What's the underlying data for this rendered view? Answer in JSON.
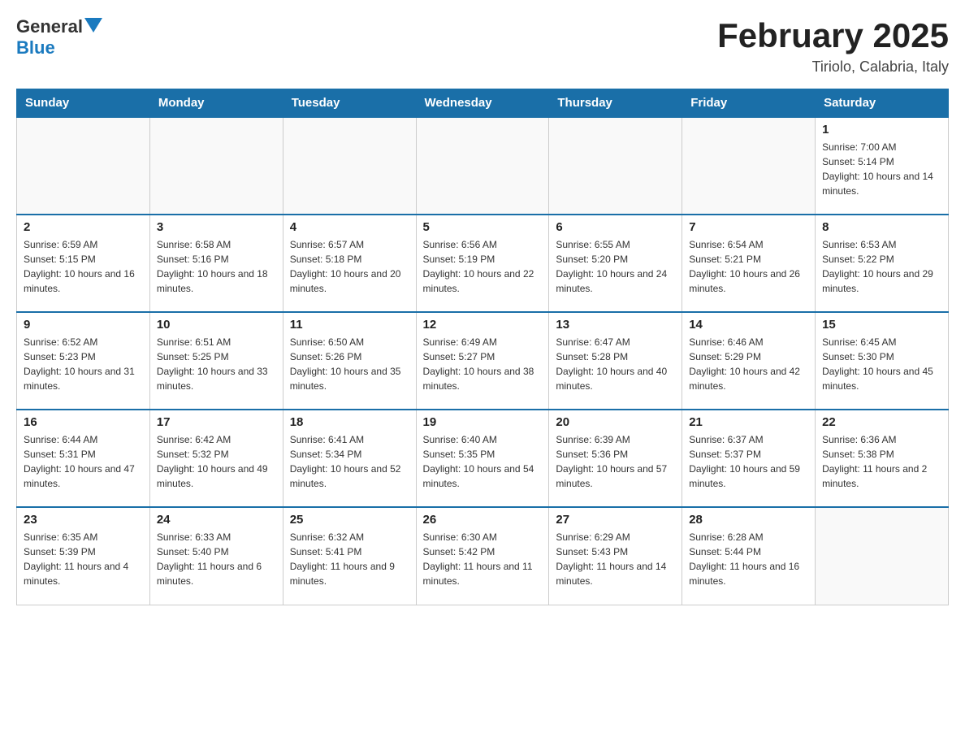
{
  "header": {
    "logo_text_general": "General",
    "logo_text_blue": "Blue",
    "title": "February 2025",
    "subtitle": "Tiriolo, Calabria, Italy"
  },
  "days_of_week": [
    "Sunday",
    "Monday",
    "Tuesday",
    "Wednesday",
    "Thursday",
    "Friday",
    "Saturday"
  ],
  "weeks": [
    {
      "days": [
        {
          "number": "",
          "info": ""
        },
        {
          "number": "",
          "info": ""
        },
        {
          "number": "",
          "info": ""
        },
        {
          "number": "",
          "info": ""
        },
        {
          "number": "",
          "info": ""
        },
        {
          "number": "",
          "info": ""
        },
        {
          "number": "1",
          "info": "Sunrise: 7:00 AM\nSunset: 5:14 PM\nDaylight: 10 hours and 14 minutes."
        }
      ]
    },
    {
      "days": [
        {
          "number": "2",
          "info": "Sunrise: 6:59 AM\nSunset: 5:15 PM\nDaylight: 10 hours and 16 minutes."
        },
        {
          "number": "3",
          "info": "Sunrise: 6:58 AM\nSunset: 5:16 PM\nDaylight: 10 hours and 18 minutes."
        },
        {
          "number": "4",
          "info": "Sunrise: 6:57 AM\nSunset: 5:18 PM\nDaylight: 10 hours and 20 minutes."
        },
        {
          "number": "5",
          "info": "Sunrise: 6:56 AM\nSunset: 5:19 PM\nDaylight: 10 hours and 22 minutes."
        },
        {
          "number": "6",
          "info": "Sunrise: 6:55 AM\nSunset: 5:20 PM\nDaylight: 10 hours and 24 minutes."
        },
        {
          "number": "7",
          "info": "Sunrise: 6:54 AM\nSunset: 5:21 PM\nDaylight: 10 hours and 26 minutes."
        },
        {
          "number": "8",
          "info": "Sunrise: 6:53 AM\nSunset: 5:22 PM\nDaylight: 10 hours and 29 minutes."
        }
      ]
    },
    {
      "days": [
        {
          "number": "9",
          "info": "Sunrise: 6:52 AM\nSunset: 5:23 PM\nDaylight: 10 hours and 31 minutes."
        },
        {
          "number": "10",
          "info": "Sunrise: 6:51 AM\nSunset: 5:25 PM\nDaylight: 10 hours and 33 minutes."
        },
        {
          "number": "11",
          "info": "Sunrise: 6:50 AM\nSunset: 5:26 PM\nDaylight: 10 hours and 35 minutes."
        },
        {
          "number": "12",
          "info": "Sunrise: 6:49 AM\nSunset: 5:27 PM\nDaylight: 10 hours and 38 minutes."
        },
        {
          "number": "13",
          "info": "Sunrise: 6:47 AM\nSunset: 5:28 PM\nDaylight: 10 hours and 40 minutes."
        },
        {
          "number": "14",
          "info": "Sunrise: 6:46 AM\nSunset: 5:29 PM\nDaylight: 10 hours and 42 minutes."
        },
        {
          "number": "15",
          "info": "Sunrise: 6:45 AM\nSunset: 5:30 PM\nDaylight: 10 hours and 45 minutes."
        }
      ]
    },
    {
      "days": [
        {
          "number": "16",
          "info": "Sunrise: 6:44 AM\nSunset: 5:31 PM\nDaylight: 10 hours and 47 minutes."
        },
        {
          "number": "17",
          "info": "Sunrise: 6:42 AM\nSunset: 5:32 PM\nDaylight: 10 hours and 49 minutes."
        },
        {
          "number": "18",
          "info": "Sunrise: 6:41 AM\nSunset: 5:34 PM\nDaylight: 10 hours and 52 minutes."
        },
        {
          "number": "19",
          "info": "Sunrise: 6:40 AM\nSunset: 5:35 PM\nDaylight: 10 hours and 54 minutes."
        },
        {
          "number": "20",
          "info": "Sunrise: 6:39 AM\nSunset: 5:36 PM\nDaylight: 10 hours and 57 minutes."
        },
        {
          "number": "21",
          "info": "Sunrise: 6:37 AM\nSunset: 5:37 PM\nDaylight: 10 hours and 59 minutes."
        },
        {
          "number": "22",
          "info": "Sunrise: 6:36 AM\nSunset: 5:38 PM\nDaylight: 11 hours and 2 minutes."
        }
      ]
    },
    {
      "days": [
        {
          "number": "23",
          "info": "Sunrise: 6:35 AM\nSunset: 5:39 PM\nDaylight: 11 hours and 4 minutes."
        },
        {
          "number": "24",
          "info": "Sunrise: 6:33 AM\nSunset: 5:40 PM\nDaylight: 11 hours and 6 minutes."
        },
        {
          "number": "25",
          "info": "Sunrise: 6:32 AM\nSunset: 5:41 PM\nDaylight: 11 hours and 9 minutes."
        },
        {
          "number": "26",
          "info": "Sunrise: 6:30 AM\nSunset: 5:42 PM\nDaylight: 11 hours and 11 minutes."
        },
        {
          "number": "27",
          "info": "Sunrise: 6:29 AM\nSunset: 5:43 PM\nDaylight: 11 hours and 14 minutes."
        },
        {
          "number": "28",
          "info": "Sunrise: 6:28 AM\nSunset: 5:44 PM\nDaylight: 11 hours and 16 minutes."
        },
        {
          "number": "",
          "info": ""
        }
      ]
    }
  ]
}
